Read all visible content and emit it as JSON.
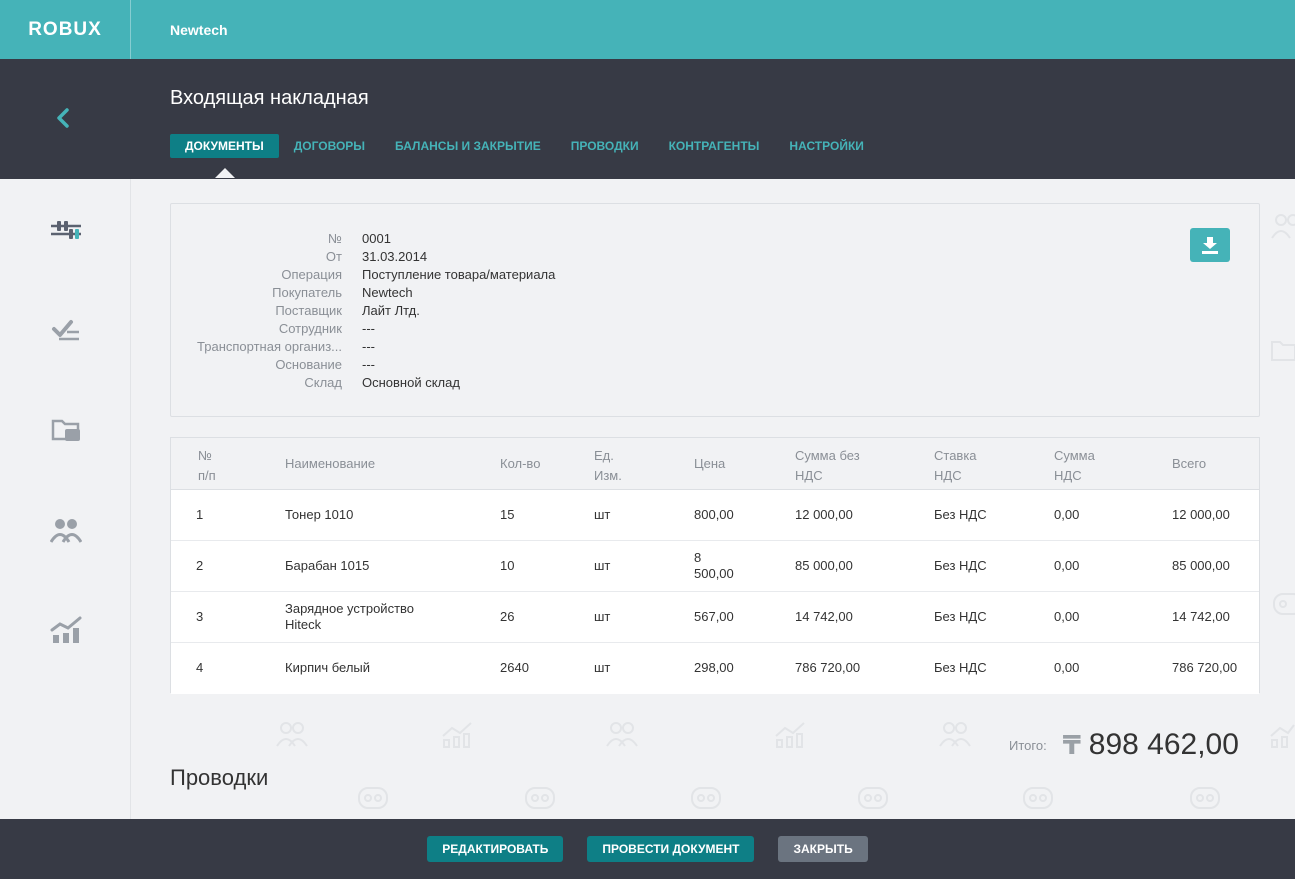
{
  "brand": {
    "logo": "ROBUX",
    "company": "Newtech"
  },
  "header": {
    "title": "Входящая накладная"
  },
  "tabs": [
    {
      "label": "ДОКУМЕНТЫ",
      "active": true
    },
    {
      "label": "ДОГОВОРЫ"
    },
    {
      "label": "БАЛАНСЫ И ЗАКРЫТИЕ"
    },
    {
      "label": "ПРОВОДКИ"
    },
    {
      "label": "КОНТРАГЕНТЫ"
    },
    {
      "label": "НАСТРОЙКИ"
    }
  ],
  "sidebar": [
    "sliders-icon",
    "checklist-icon",
    "folder-icon",
    "users-icon",
    "chart-icon"
  ],
  "document": {
    "fields": [
      {
        "label": "№",
        "value": "0001"
      },
      {
        "label": "От",
        "value": "31.03.2014"
      },
      {
        "label": "Операция",
        "value": "Поступление товара/материала"
      },
      {
        "label": "Покупатель",
        "value": "Newtech"
      },
      {
        "label": "Поставщик",
        "value": "Лайт Лтд."
      },
      {
        "label": "Сотрудник",
        "value": "---"
      },
      {
        "label": "Транспортная организ...",
        "value": "---"
      },
      {
        "label": "Основание",
        "value": "---"
      },
      {
        "label": "Склад",
        "value": "Основной склад"
      }
    ]
  },
  "table": {
    "headers": {
      "num": [
        "№",
        "п/п"
      ],
      "name": "Наименование",
      "qty": "Кол-во",
      "unit": [
        "Ед.",
        "Изм."
      ],
      "price": "Цена",
      "sum": [
        "Сумма без",
        "НДС"
      ],
      "rate": [
        "Ставка",
        "НДС"
      ],
      "vat": [
        "Сумма",
        "НДС"
      ],
      "total": "Всего"
    },
    "rows": [
      {
        "num": "1",
        "name": "Тонер 1010",
        "qty": "15",
        "unit": "шт",
        "price": "800,00",
        "sum": "12 000,00",
        "rate": "Без НДС",
        "vat": "0,00",
        "total": "12 000,00"
      },
      {
        "num": "2",
        "name": "Барабан 1015",
        "qty": "10",
        "unit": "шт",
        "price": "8 500,00",
        "sum": "85 000,00",
        "rate": "Без НДС",
        "vat": "0,00",
        "total": "85 000,00"
      },
      {
        "num": "3",
        "name": "Зарядное устройство Hiteck",
        "qty": "26",
        "unit": "шт",
        "price": "567,00",
        "sum": "14 742,00",
        "rate": "Без НДС",
        "vat": "0,00",
        "total": "14 742,00"
      },
      {
        "num": "4",
        "name": "Кирпич белый",
        "qty": "2640",
        "unit": "шт",
        "price": "298,00",
        "sum": "786 720,00",
        "rate": "Без НДС",
        "vat": "0,00",
        "total": "786 720,00"
      }
    ]
  },
  "summary": {
    "label": "Итого:",
    "currency_symbol": "₸",
    "value": "898 462,00"
  },
  "section": {
    "title": "Проводки"
  },
  "footer": {
    "edit": "РЕДАКТИРОВАТЬ",
    "post": "ПРОВЕСТИ ДОКУМЕНТ",
    "close": "ЗАКРЫТЬ"
  },
  "colors": {
    "accent": "#45b3b8",
    "dark": "#373a45",
    "button": "#0e7f86",
    "grey_button": "#6b7480"
  }
}
